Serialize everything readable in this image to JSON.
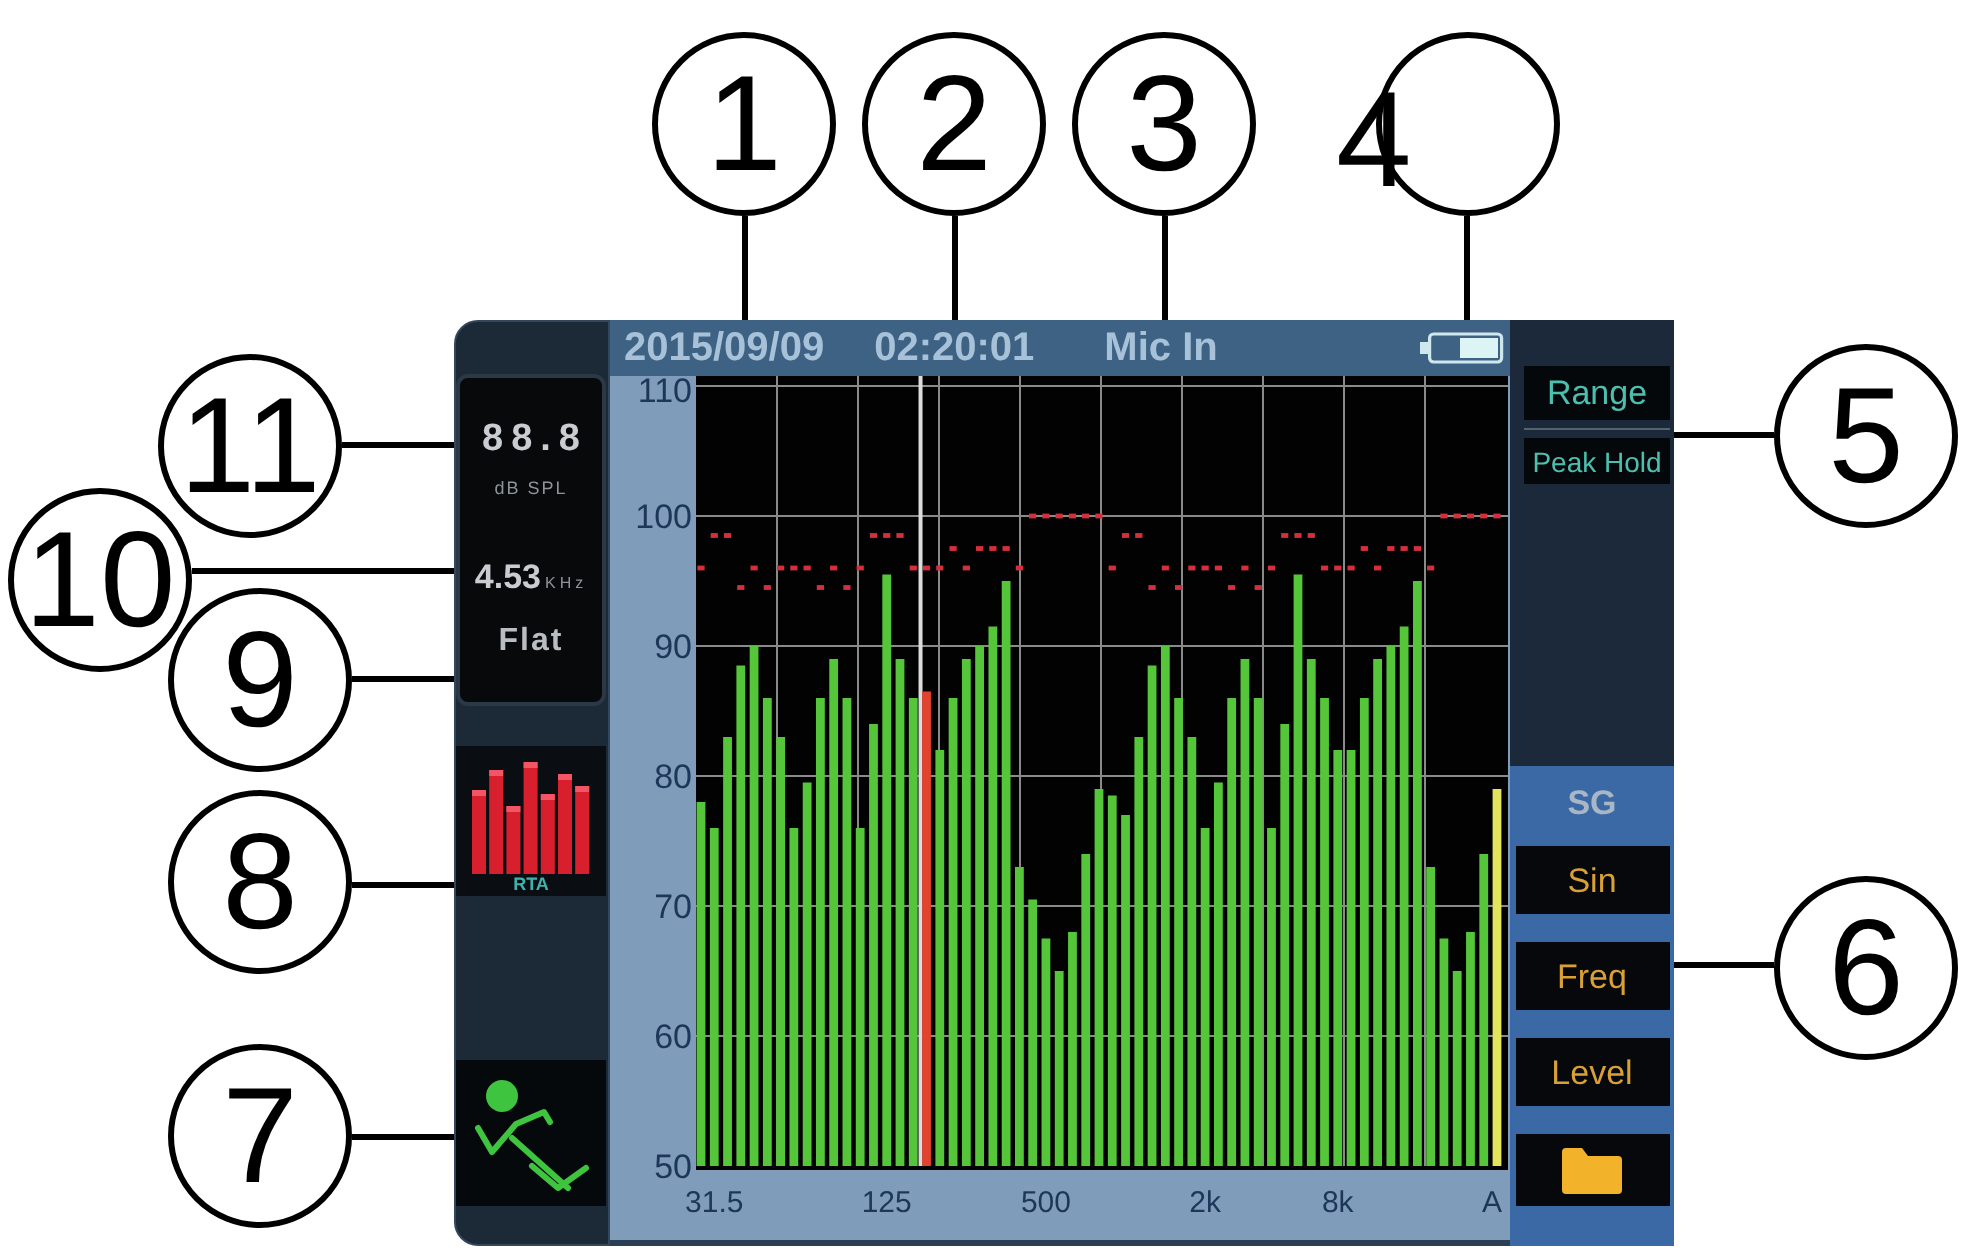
{
  "callouts": [
    {
      "label": "1"
    },
    {
      "label": "2"
    },
    {
      "label": "3"
    },
    {
      "label": "4"
    },
    {
      "label": "11"
    },
    {
      "label": "5"
    },
    {
      "label": "10"
    },
    {
      "label": "9"
    },
    {
      "label": "8"
    },
    {
      "label": "6"
    },
    {
      "label": "7"
    }
  ],
  "status_bar": {
    "date": "2015/09/09",
    "time": "02:20:01",
    "input": "Mic In"
  },
  "readout": {
    "spl_value": "88.8",
    "spl_unit": "dB SPL",
    "frequency_value": "4.53",
    "frequency_unit": "KHz",
    "weighting": "Flat"
  },
  "mode_button": {
    "label": "RTA"
  },
  "plot": {
    "chart_data": {
      "type": "bar",
      "ylim": [
        50,
        110
      ],
      "yticks": [
        50,
        60,
        70,
        80,
        90,
        100,
        110
      ],
      "grid": true,
      "categories": [
        null,
        "31.5",
        null,
        null,
        null,
        null,
        null,
        null,
        null,
        null,
        null,
        null,
        null,
        null,
        "125",
        null,
        null,
        null,
        null,
        null,
        null,
        null,
        null,
        null,
        null,
        null,
        "500",
        null,
        null,
        null,
        null,
        null,
        null,
        null,
        null,
        null,
        null,
        null,
        "2k",
        null,
        null,
        null,
        null,
        null,
        null,
        null,
        null,
        null,
        "8k",
        null,
        null,
        null,
        null,
        null,
        null,
        null,
        null,
        null,
        null,
        null,
        "A"
      ],
      "series": [
        {
          "color": "#55c63a",
          "values": [
            78,
            76,
            83,
            88.5,
            90,
            86,
            83,
            76,
            79.5,
            86,
            89,
            86,
            76,
            84,
            95.5,
            89,
            86,
            null,
            82,
            86,
            89,
            90,
            91.5,
            95,
            73,
            70.5,
            67.5,
            65,
            68,
            74,
            79,
            78.5,
            77,
            83,
            88.5,
            90,
            86,
            83,
            76,
            79.5,
            86,
            89,
            86,
            76,
            84,
            95.5,
            89,
            86,
            82,
            82,
            86,
            89,
            90,
            91.5,
            95,
            73,
            67.5,
            65,
            68,
            74,
            null
          ]
        },
        {
          "color": "#e2432e",
          "values": [
            null,
            null,
            null,
            null,
            null,
            null,
            null,
            null,
            null,
            null,
            null,
            null,
            null,
            null,
            null,
            null,
            null,
            86.5,
            null,
            null,
            null,
            null,
            null,
            null,
            null,
            null,
            null,
            null,
            null,
            null,
            null,
            null,
            null,
            null,
            null,
            null,
            null,
            null,
            null,
            null,
            null,
            null,
            null,
            null,
            null,
            null,
            null,
            null,
            null,
            null,
            null,
            null,
            null,
            null,
            null,
            null,
            null,
            null,
            null,
            null,
            null
          ]
        },
        {
          "color": "#e2e45c",
          "values": [
            null,
            null,
            null,
            null,
            null,
            null,
            null,
            null,
            null,
            null,
            null,
            null,
            null,
            null,
            null,
            null,
            null,
            null,
            null,
            null,
            null,
            null,
            null,
            null,
            null,
            null,
            null,
            null,
            null,
            null,
            null,
            null,
            null,
            null,
            null,
            null,
            null,
            null,
            null,
            null,
            null,
            null,
            null,
            null,
            null,
            null,
            null,
            null,
            null,
            null,
            null,
            null,
            null,
            null,
            null,
            null,
            null,
            null,
            null,
            null,
            79
          ]
        },
        {
          "type": "scatter",
          "color": "#d4303c",
          "values": [
            96,
            98.5,
            98.5,
            94.5,
            96,
            94.5,
            96,
            96,
            96,
            94.5,
            96,
            94.5,
            96,
            98.5,
            98.5,
            98.5,
            96,
            96,
            96,
            97.5,
            96,
            97.5,
            97.5,
            97.5,
            96,
            100,
            100,
            100,
            100,
            100,
            100,
            96,
            98.5,
            98.5,
            94.5,
            96,
            94.5,
            96,
            96,
            96,
            94.5,
            96,
            94.5,
            96,
            98.5,
            98.5,
            98.5,
            96,
            96,
            96,
            97.5,
            96,
            97.5,
            97.5,
            97.5,
            96,
            100,
            100,
            100,
            100,
            100
          ]
        }
      ]
    }
  },
  "display_options": [
    {
      "label": "Range"
    },
    {
      "label": "Peak Hold"
    }
  ],
  "signal_generator": {
    "title": "SG",
    "buttons": [
      {
        "label": "Sin"
      },
      {
        "label": "Freq"
      },
      {
        "label": "Level"
      }
    ]
  }
}
